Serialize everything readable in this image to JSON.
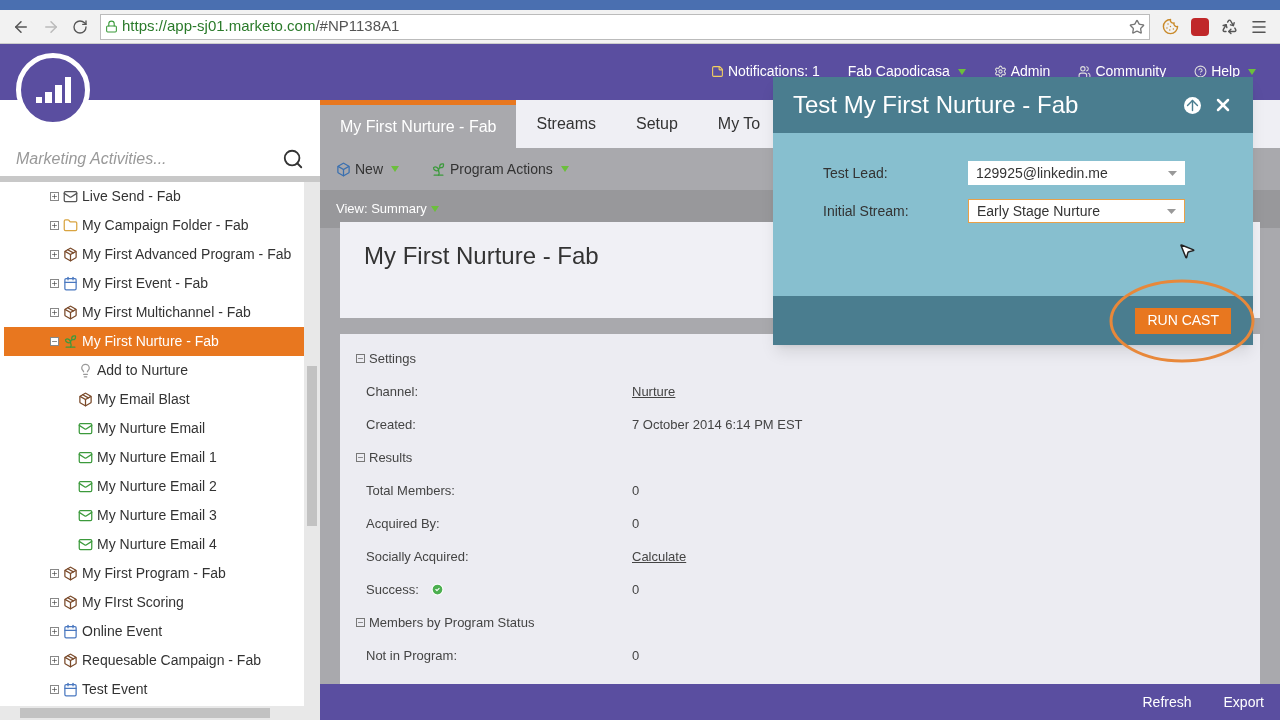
{
  "browser": {
    "url_host": "https://app-sj01.marketo.com",
    "url_path": "/#NP1138A1"
  },
  "header": {
    "links": [
      {
        "kind": "notes",
        "label": "Notifications: 1"
      },
      {
        "kind": "user",
        "label": "Fab Capodicasa"
      },
      {
        "kind": "gear",
        "label": "Admin"
      },
      {
        "kind": "people",
        "label": "Community"
      },
      {
        "kind": "help",
        "label": "Help"
      }
    ]
  },
  "sidebar": {
    "search": {
      "placeholder": "Marketing Activities..."
    },
    "tree": [
      {
        "label": "Live Send - Fab",
        "kind": "mail",
        "expanded": false,
        "selected": false
      },
      {
        "label": "My Campaign Folder - Fab",
        "kind": "folder",
        "expanded": false,
        "selected": false
      },
      {
        "label": "My First Advanced Program - Fab",
        "kind": "program",
        "expanded": false,
        "selected": false
      },
      {
        "label": "My First Event - Fab",
        "kind": "event",
        "expanded": false,
        "selected": false
      },
      {
        "label": "My First Multichannel - Fab",
        "kind": "program",
        "expanded": false,
        "selected": false
      },
      {
        "label": "My First Nurture - Fab",
        "kind": "nurture",
        "expanded": true,
        "selected": true,
        "children": [
          {
            "label": "Add to Nurture",
            "kind": "bulb",
            "selected": false
          },
          {
            "label": "My Email Blast",
            "kind": "program",
            "selected": false
          },
          {
            "label": "My Nurture Email",
            "kind": "email",
            "selected": false
          },
          {
            "label": "My Nurture Email 1",
            "kind": "email",
            "selected": false
          },
          {
            "label": "My Nurture Email 2",
            "kind": "email",
            "selected": false
          },
          {
            "label": "My Nurture Email 3",
            "kind": "email",
            "selected": false
          },
          {
            "label": "My Nurture Email 4",
            "kind": "email",
            "selected": false
          }
        ]
      },
      {
        "label": "My First Program - Fab",
        "kind": "program",
        "expanded": false,
        "selected": false
      },
      {
        "label": "My FIrst Scoring",
        "kind": "program",
        "expanded": false,
        "selected": false
      },
      {
        "label": "Online Event",
        "kind": "event",
        "expanded": false,
        "selected": false
      },
      {
        "label": "Requesable Campaign - Fab",
        "kind": "program",
        "expanded": false,
        "selected": false
      },
      {
        "label": "Test Event",
        "kind": "event",
        "expanded": false,
        "selected": false
      }
    ]
  },
  "tabs": [
    {
      "label": "My First Nurture - Fab",
      "selected": true
    },
    {
      "label": "Streams",
      "selected": false
    },
    {
      "label": "Setup",
      "selected": false
    },
    {
      "label": "My To",
      "selected": false
    }
  ],
  "toolbar": [
    {
      "kind": "new",
      "label": "New"
    },
    {
      "kind": "actions",
      "label": "Program Actions"
    }
  ],
  "view": {
    "label": "View: Summary"
  },
  "program_title": "My First Nurture - Fab",
  "sections": [
    {
      "title": "Settings",
      "expanded": true,
      "rows": [
        {
          "label": "Channel:",
          "value": "Nurture",
          "link": true
        },
        {
          "label": "Created:",
          "value": "7 October 2014 6:14 PM EST",
          "link": false
        }
      ]
    },
    {
      "title": "Results",
      "expanded": true,
      "rows": [
        {
          "label": "Total Members:",
          "value": "0",
          "link": false
        },
        {
          "label": "Acquired By:",
          "value": "0",
          "link": false
        },
        {
          "label": "Socially Acquired:",
          "value": "Calculate",
          "link": true
        },
        {
          "label": "Success:",
          "value": "0",
          "link": false,
          "success": true
        }
      ]
    },
    {
      "title": "Members by Program Status",
      "expanded": true,
      "rows": [
        {
          "label": "Not in Program:",
          "value": "0",
          "link": false
        }
      ]
    }
  ],
  "footer": [
    "Refresh",
    "Export"
  ],
  "dialog": {
    "title": "Test My First Nurture - Fab",
    "fields": [
      {
        "label": "Test Lead:",
        "value": "129925@linkedin.me",
        "focused": false
      },
      {
        "label": "Initial Stream:",
        "value": "Early Stage Nurture",
        "focused": true
      }
    ],
    "button": "RUN CAST"
  }
}
